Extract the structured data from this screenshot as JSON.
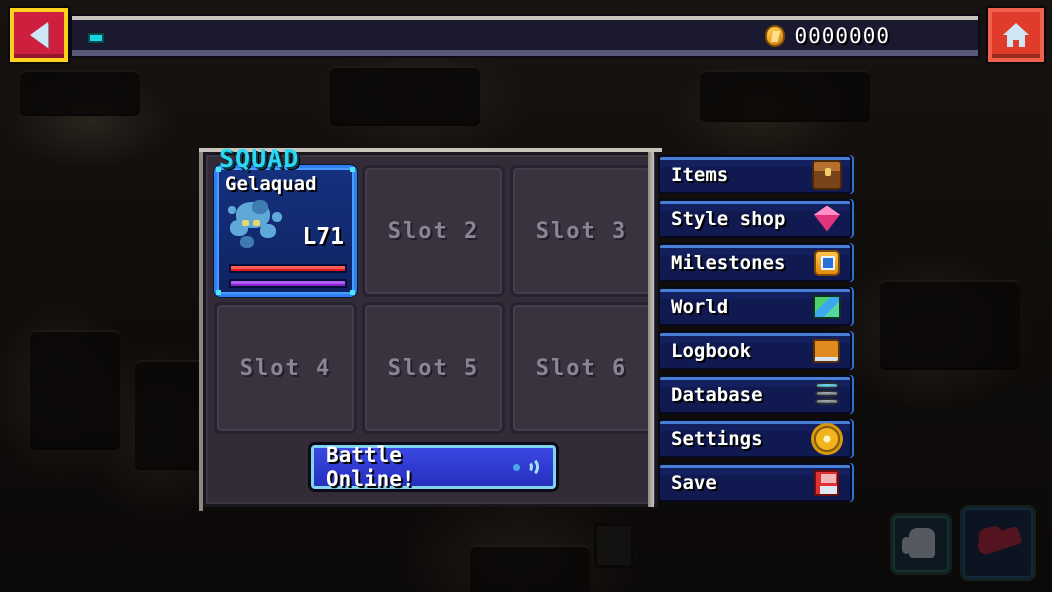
{
  "topbar": {
    "coin_count": "0000000",
    "coin_icon": "gold-coin-icon",
    "indicator": "cyan-progress-pip"
  },
  "nav": {
    "back_label": "back-arrow-icon",
    "home_label": "home-icon"
  },
  "squad": {
    "panel_title": "SQUAD",
    "slots": [
      {
        "name": "Gelaquad",
        "level": "L71",
        "filled": true,
        "hp_percent": 100,
        "xp_percent": 100,
        "sprite": "blue-gel-creature-sprite"
      },
      {
        "name": "Slot 2",
        "filled": false
      },
      {
        "name": "Slot 3",
        "filled": false
      },
      {
        "name": "Slot 4",
        "filled": false
      },
      {
        "name": "Slot 5",
        "filled": false
      },
      {
        "name": "Slot 6",
        "filled": false
      }
    ],
    "battle_button": {
      "label": "Battle Online!",
      "icon": "wifi-broadcast-icon"
    }
  },
  "menu": {
    "items": [
      {
        "label": "Items",
        "icon": "treasure-bag-icon"
      },
      {
        "label": "Style shop",
        "icon": "pink-gem-icon"
      },
      {
        "label": "Milestones",
        "icon": "medal-icon"
      },
      {
        "label": "World",
        "icon": "world-map-icon"
      },
      {
        "label": "Logbook",
        "icon": "book-icon"
      },
      {
        "label": "Database",
        "icon": "database-server-icon"
      },
      {
        "label": "Settings",
        "icon": "gear-icon"
      },
      {
        "label": "Save",
        "icon": "floppy-disk-icon"
      }
    ]
  },
  "hud": {
    "hand_button": "hand-icon",
    "shoe_button": "running-shoe-icon"
  },
  "colors": {
    "accent_cyan": "#2bd8f2",
    "selected_blue": "#2f7ff0",
    "menu_blue": "#14205e",
    "panel_grey": "#332c38",
    "hp_red": "#e01c1c",
    "xp_purple": "#8a25d6",
    "coin_gold": "#f2a82c",
    "back_red": "#cf1f3f",
    "back_border_yellow": "#ffd21e",
    "home_red": "#e03c2c"
  }
}
